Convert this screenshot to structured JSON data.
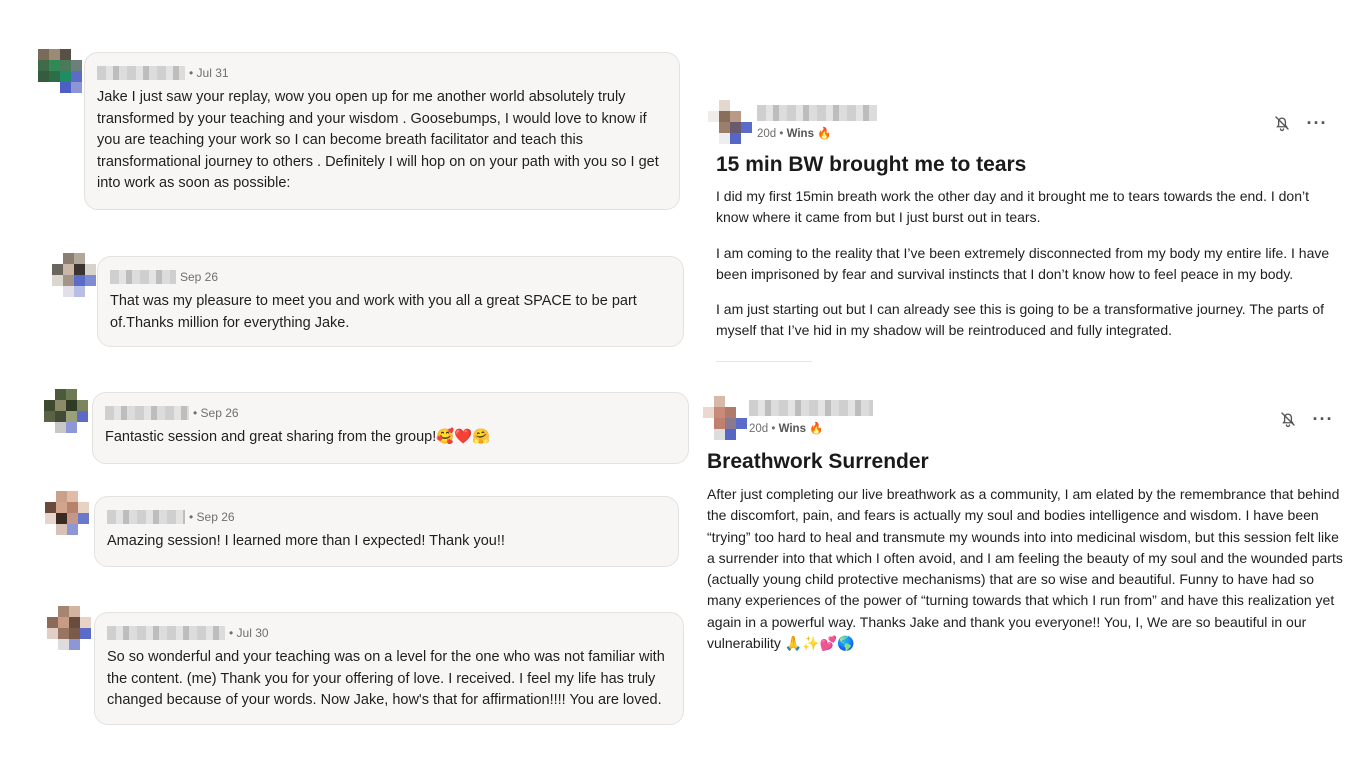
{
  "comments": [
    {
      "date": "• Jul 31",
      "text": "Jake I just saw your replay, wow you open up for me another world absolutely truly transformed by your teaching and your wisdom . Goosebumps, I would love to know if you are teaching your work so I can become breath facilitator and teach this transformational journey to others . Definitely I will hop on on your path with you so I get into work as soon as possible:"
    },
    {
      "date": "Sep 26",
      "text": "That was my pleasure to meet you and work with you all a great SPACE to be part of.Thanks million for everything Jake."
    },
    {
      "date": "• Sep 26",
      "text": "Fantastic session and great sharing from the group!🥰❤️🤗"
    },
    {
      "date": "• Sep 26",
      "text": "Amazing session! I learned more than I expected! Thank you!!"
    },
    {
      "date": "• Jul 30",
      "text": "So so wonderful and your teaching was on a level for the one who was not familiar with the content. (me) Thank you for your offering of love. I received. I feel my life has truly changed because of your words. Now Jake, how's that for affirmation!!!! You are loved."
    }
  ],
  "posts": [
    {
      "age": "20d",
      "separator": " • ",
      "category": "Wins 🔥",
      "title": "15 min BW brought me to tears",
      "paragraphs": [
        "I did my first 15min breath work the other day and it brought me to tears towards the end. I don’t know where it came from but I just burst out in tears.",
        "I am coming to the reality that I’ve been extremely disconnected from my body my entire life. I have been imprisoned by fear and survival instincts that I don’t know how to feel peace in my body.",
        "I am just starting out but I can already see this is going to be a transformative journey. The parts of myself that I’ve hid in my shadow will be reintroduced and fully integrated."
      ]
    },
    {
      "age": "20d",
      "separator": " • ",
      "category": "Wins 🔥",
      "title": "Breathwork Surrender",
      "paragraphs": [
        "After just completing our live breathwork as a community, I am elated by the remembrance that behind the discomfort, pain, and fears is actually my soul and bodies intelligence and wisdom. I have been “trying” too hard to heal and transmute my wounds into into medicinal wisdom, but this session felt like a surrender into that which I often avoid, and I am feeling the beauty of my soul and the wounded parts (actually young child protective mechanisms) that are so wise and beautiful. Funny to have had so many experiences of the power of “turning towards that which I run from” and have this realization yet again in a powerful way. Thanks Jake and thank you everyone!! You, I, We are so beautiful in our vulnerability 🙏✨💕🌎"
      ]
    }
  ],
  "icons": {
    "bell": "bell-off-icon",
    "more": "more-horizontal-icon"
  },
  "colors": {
    "bubble_bg": "#f7f6f5",
    "bubble_border": "#e4e2df",
    "meta_text": "#6f6f6f"
  }
}
